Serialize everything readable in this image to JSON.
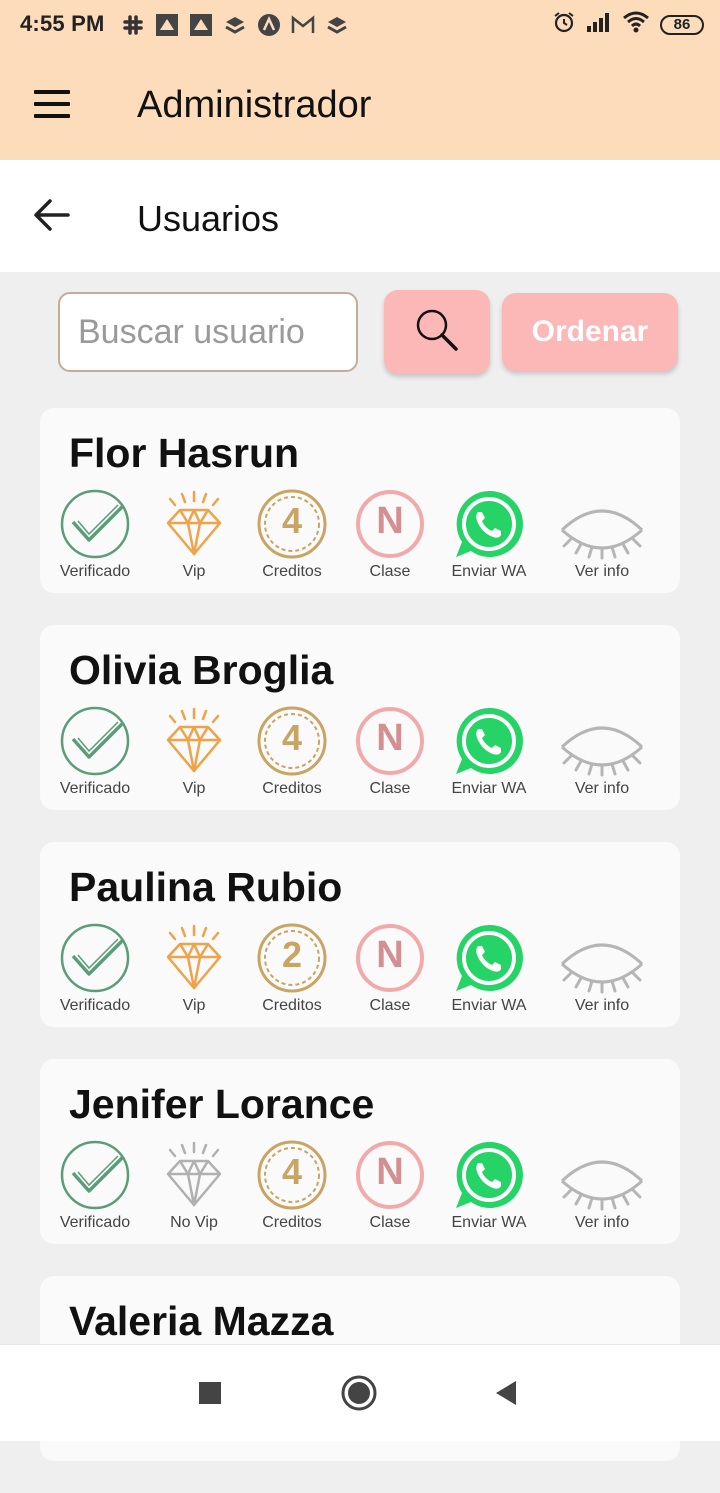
{
  "status": {
    "time": "4:55 PM",
    "battery": "86"
  },
  "appbar": {
    "title": "Administrador"
  },
  "subheader": {
    "title": "Usuarios"
  },
  "search": {
    "placeholder": "Buscar usuario"
  },
  "sort": {
    "label": "Ordenar"
  },
  "users": [
    {
      "name": "Flor Hasrun",
      "verified_label": "Verificado",
      "vip_label": "Vip",
      "vip": true,
      "credits": "4",
      "credits_label": "Creditos",
      "class": "N",
      "class_label": "Clase",
      "wa_label": "Enviar WA",
      "info_label": "Ver info"
    },
    {
      "name": "Olivia Broglia",
      "verified_label": "Verificado",
      "vip_label": "Vip",
      "vip": true,
      "credits": "4",
      "credits_label": "Creditos",
      "class": "N",
      "class_label": "Clase",
      "wa_label": "Enviar WA",
      "info_label": "Ver info"
    },
    {
      "name": "Paulina Rubio",
      "verified_label": "Verificado",
      "vip_label": "Vip",
      "vip": true,
      "credits": "2",
      "credits_label": "Creditos",
      "class": "N",
      "class_label": "Clase",
      "wa_label": "Enviar WA",
      "info_label": "Ver info"
    },
    {
      "name": "Jenifer Lorance",
      "verified_label": "Verificado",
      "vip_label": "No Vip",
      "vip": false,
      "credits": "4",
      "credits_label": "Creditos",
      "class": "N",
      "class_label": "Clase",
      "wa_label": "Enviar WA",
      "info_label": "Ver info"
    },
    {
      "name": "Valeria Mazza"
    }
  ],
  "icons": {
    "menu": "hamburger-menu-icon",
    "back": "arrow-left-icon",
    "search": "magnifier-icon",
    "verified": "check-circle-icon",
    "vip": "diamond-icon",
    "credits": "coin-icon",
    "class": "letter-circle-icon",
    "whatsapp": "whatsapp-icon",
    "info": "closed-eye-icon"
  },
  "colors": {
    "header_bg": "#fddcbb",
    "button_bg": "#fbb8b6",
    "verified": "#5a9d78",
    "vip": "#f0a24a",
    "no_vip": "#b0b0b0",
    "credits": "#c9a463",
    "class": "#f2a9aa",
    "whatsapp": "#25d366",
    "info": "#b5b5b5"
  }
}
